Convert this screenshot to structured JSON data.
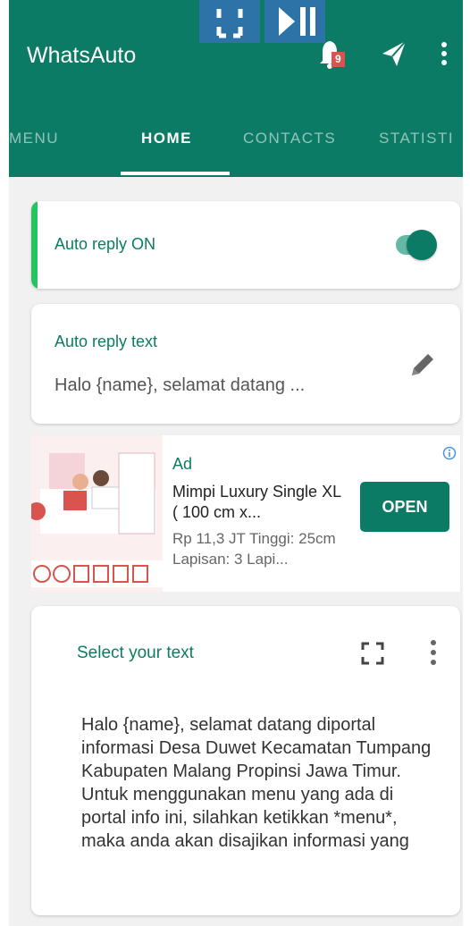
{
  "app": {
    "title": "WhatsAuto"
  },
  "toolbar": {
    "notification_count": "9"
  },
  "tabs": [
    {
      "label": "MENU"
    },
    {
      "label": "HOME"
    },
    {
      "label": "CONTACTS"
    },
    {
      "label": "STATISTI"
    }
  ],
  "active_tab": "HOME",
  "auto_reply": {
    "label": "Auto reply ON",
    "enabled": true
  },
  "reply_text_card": {
    "label": "Auto reply text",
    "value": "Halo {name}, selamat datang ..."
  },
  "ad": {
    "badge": "Ad",
    "title": "Mimpi Luxury Single XL ( 100 cm x...",
    "description": "Rp 11,3 JT Tinggi: 25cm Lapisan: 3 Lapi...",
    "button": "OPEN"
  },
  "select_card": {
    "label": "Select your text",
    "body": "Halo {name}, selamat datang diportal informasi Desa Duwet Kecamatan Tumpang Kabupaten Malang Propinsi Jawa Timur. Untuk menggunakan menu yang ada di portal info ini, silahkan ketikkan *menu*, maka anda akan disajikan informasi yang"
  },
  "colors": {
    "primary": "#0c7b65",
    "accent_bar": "#22c55e",
    "overlay": "#2e73a8",
    "badge": "#d9534f"
  }
}
